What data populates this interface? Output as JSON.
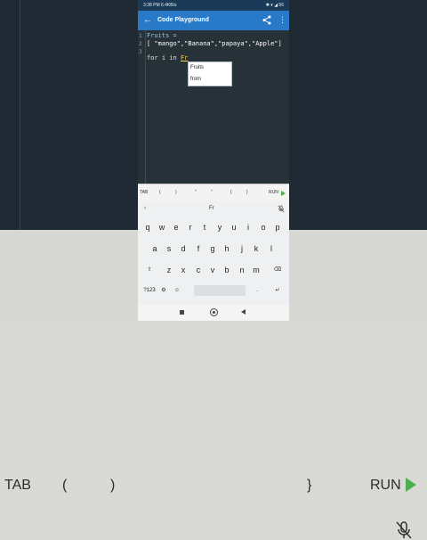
{
  "status_bar": {
    "time": "3:38 PM",
    "speed": "6.4KB/s",
    "icons_text": "✱ ▾ ◢ 56"
  },
  "app": {
    "back_icon": "back-arrow-icon",
    "title": "Code Playground",
    "share_icon": "share-icon",
    "more_icon": "more-vert-icon"
  },
  "editor": {
    "line_numbers": [
      "1",
      "2",
      "3"
    ],
    "line1": "Fruits =",
    "line2": "[ \"mango\",\"Banana\",\"papaya\",\"Apple\"]",
    "line3_prefix": "for i in ",
    "line3_typed": "Fr"
  },
  "autocomplete": {
    "items": [
      "Fruits",
      "from"
    ]
  },
  "toolbar": {
    "tab": "TAB",
    "keys": [
      "(",
      ")",
      "\"",
      "\"",
      "{",
      "}"
    ],
    "run": "RUN"
  },
  "keyboard": {
    "suggestion": "Fr",
    "row1": [
      "q",
      "w",
      "e",
      "r",
      "t",
      "y",
      "u",
      "i",
      "o",
      "p"
    ],
    "row2": [
      "a",
      "s",
      "d",
      "f",
      "g",
      "h",
      "j",
      "k",
      "l"
    ],
    "row3": [
      "z",
      "x",
      "c",
      "v",
      "b",
      "n",
      "m"
    ],
    "symbols": "?123",
    "comma": ",",
    "period": "."
  },
  "background": {
    "tab": "TAB",
    "open_paren": "(",
    "close_paren": ")",
    "close_brace": "}",
    "run": "RUN"
  },
  "colors": {
    "appbar": "#2979c9",
    "editor_bg": "#263238",
    "run_green": "#4caf50"
  }
}
